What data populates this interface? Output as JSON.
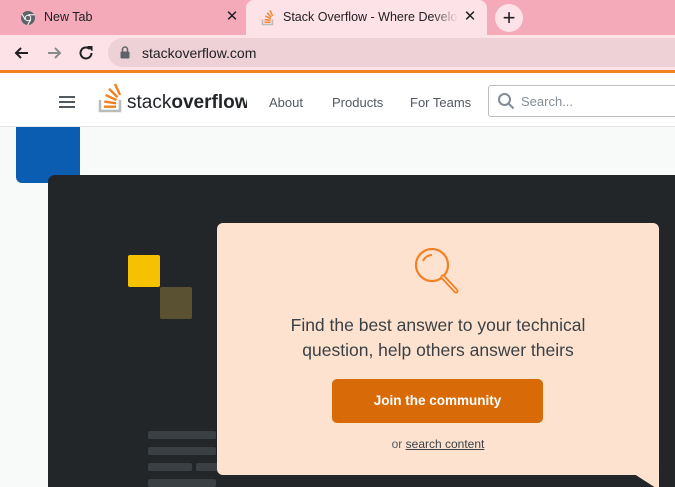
{
  "browser": {
    "tabs": [
      {
        "title": "New Tab",
        "icon": "chrome-icon",
        "active": false
      },
      {
        "title": "Stack Overflow - Where Developers Learn, Share, & Build Careers",
        "icon": "stackoverflow-icon",
        "active": true
      }
    ],
    "new_tab_label": "+",
    "close_glyph": "✕",
    "url": "stackoverflow.com"
  },
  "header": {
    "logo_text_light": "stack",
    "logo_text_bold": "overflow",
    "nav": [
      "About",
      "Products",
      "For Teams"
    ],
    "search_placeholder": "Search..."
  },
  "hero_card": {
    "icon": "magnifier-icon",
    "text_line1": "Find the best answer to your technical",
    "text_line2": "question, help others answer theirs",
    "button_label": "Join the community",
    "or_prefix": "or ",
    "search_link": "search content"
  },
  "colors": {
    "accent": "#f48024",
    "button": "#d86b08",
    "card_bg": "#fde3cf",
    "dark_panel": "#232629",
    "blue": "#0a5db0",
    "yellow": "#f6c200",
    "tab_strip": "#f4aab8"
  }
}
